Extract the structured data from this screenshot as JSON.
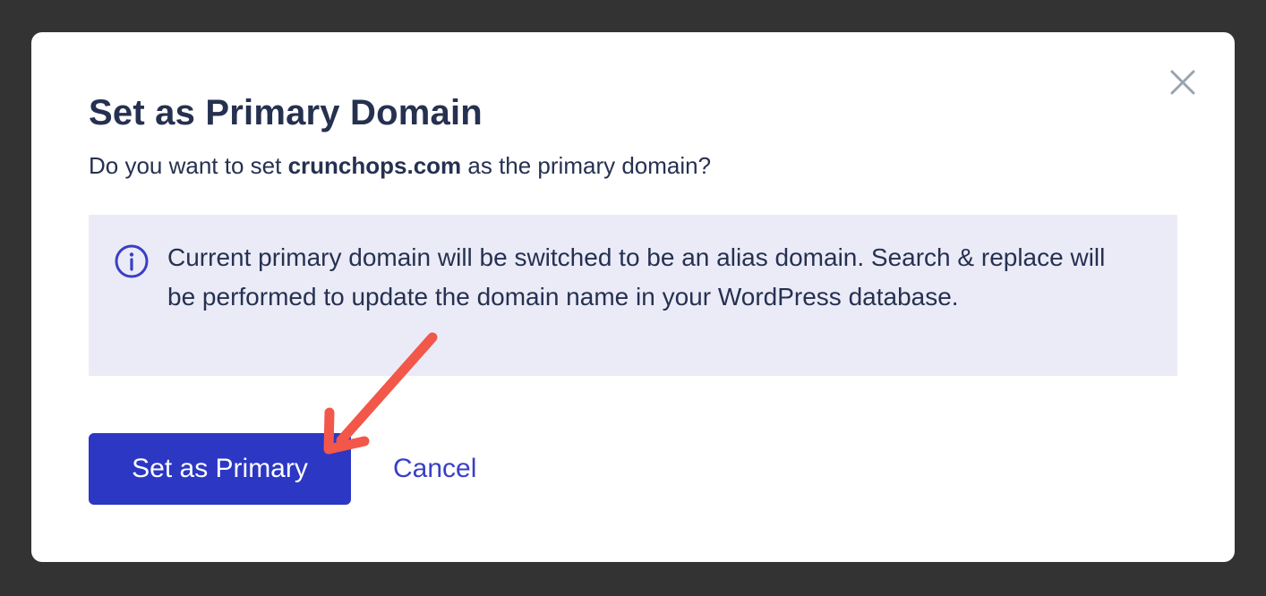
{
  "modal": {
    "title": "Set as Primary Domain",
    "question_prefix": "Do you want to set ",
    "domain": "crunchops.com",
    "question_suffix": " as the primary domain?",
    "info_text": "Current primary domain will be switched to be an alias domain. Search & replace will be performed to update the domain name in your WordPress database.",
    "primary_button_label": "Set as Primary",
    "cancel_button_label": "Cancel",
    "close_icon": "close-icon",
    "info_icon": "info-icon"
  },
  "colors": {
    "backdrop": "#333333",
    "text": "#263150",
    "primary": "#2c37c4",
    "info_bg": "#ebebf8",
    "annotation_arrow": "#f2574a"
  }
}
